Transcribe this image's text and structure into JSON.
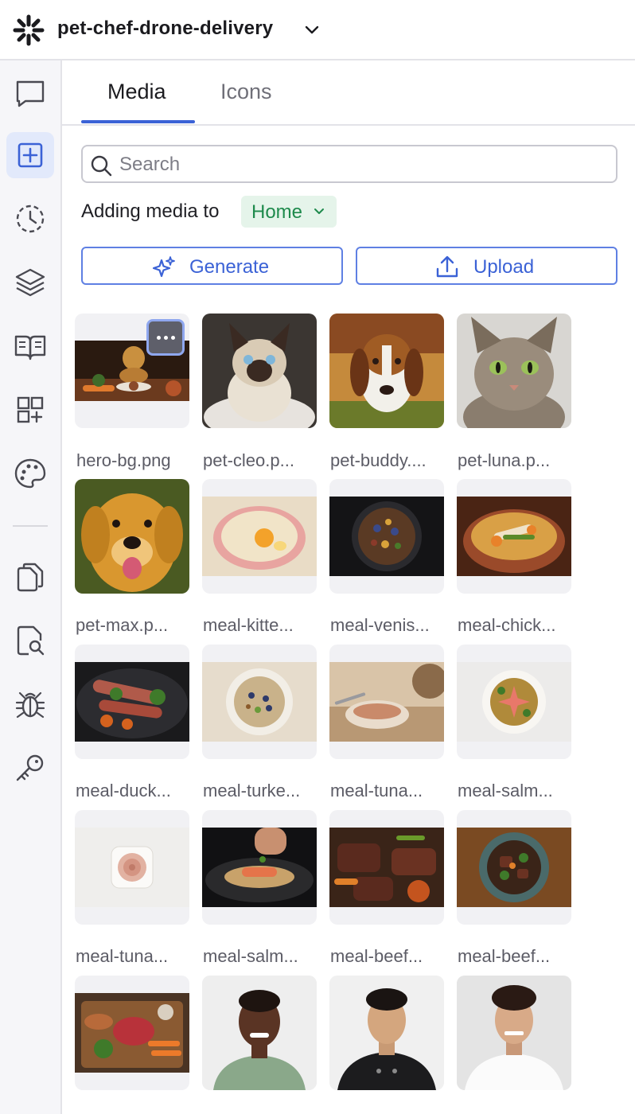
{
  "header": {
    "project_name": "pet-chef-drone-delivery",
    "logo_icon": "starburst-logo-icon",
    "chevron_icon": "chevron-down-icon"
  },
  "rail": {
    "items": [
      {
        "name": "chat-icon",
        "active": false
      },
      {
        "name": "add-square-icon",
        "active": true
      },
      {
        "name": "history-clock-icon",
        "active": false
      },
      {
        "name": "layers-icon",
        "active": false
      },
      {
        "name": "book-open-icon",
        "active": false
      },
      {
        "name": "add-grid-icon",
        "active": false
      },
      {
        "name": "palette-icon",
        "active": false
      },
      {
        "name": "copy-pages-icon",
        "active": false
      },
      {
        "name": "search-document-icon",
        "active": false
      },
      {
        "name": "bug-icon",
        "active": false
      },
      {
        "name": "key-icon",
        "active": false
      }
    ]
  },
  "tabs": [
    {
      "label": "Media",
      "active": true
    },
    {
      "label": "Icons",
      "active": false
    }
  ],
  "search": {
    "placeholder": "Search",
    "value": ""
  },
  "adding_media": {
    "label": "Adding media to",
    "target": "Home"
  },
  "actions": {
    "generate_label": "Generate",
    "upload_label": "Upload"
  },
  "media": [
    {
      "caption": "hero-bg.png",
      "subject": "golden dog with vegetables and meal"
    },
    {
      "caption": "pet-cleo.p...",
      "subject": "siamese cat"
    },
    {
      "caption": "pet-buddy....",
      "subject": "beagle dog"
    },
    {
      "caption": "pet-luna.p...",
      "subject": "tabby cat"
    },
    {
      "caption": "pet-max.p...",
      "subject": "golden retriever"
    },
    {
      "caption": "meal-kitte...",
      "subject": "egg custard in pink bowl"
    },
    {
      "caption": "meal-venis...",
      "subject": "venison and blueberry bowl"
    },
    {
      "caption": "meal-chick...",
      "subject": "chicken and green bean stew"
    },
    {
      "caption": "meal-duck...",
      "subject": "sliced duck with kale"
    },
    {
      "caption": "meal-turke...",
      "subject": "turkey grain bowl"
    },
    {
      "caption": "meal-tuna...",
      "subject": "tuna mousse with cat paw"
    },
    {
      "caption": "meal-salm...",
      "subject": "salmon bowl on marble"
    },
    {
      "caption": "meal-tuna...",
      "subject": "tuna swirl in square dish"
    },
    {
      "caption": "meal-salm...",
      "subject": "salmon rice being garnished"
    },
    {
      "caption": "meal-beef...",
      "subject": "beef with carrots and sweet potato"
    },
    {
      "caption": "meal-beef...",
      "subject": "beef stew bowl"
    },
    {
      "caption": "",
      "subject": "raw steak with vegetables"
    },
    {
      "caption": "",
      "subject": "chef portrait green uniform"
    },
    {
      "caption": "",
      "subject": "chef portrait black uniform"
    },
    {
      "caption": "",
      "subject": "chef portrait white uniform"
    }
  ],
  "colors": {
    "accent": "#3b62d6",
    "accent_border": "#5f80e3",
    "success_text": "#1e8a4c",
    "success_bg": "#e5f4ea",
    "rail_bg": "#f6f6f9",
    "active_rail_bg": "#e2e9fb"
  }
}
